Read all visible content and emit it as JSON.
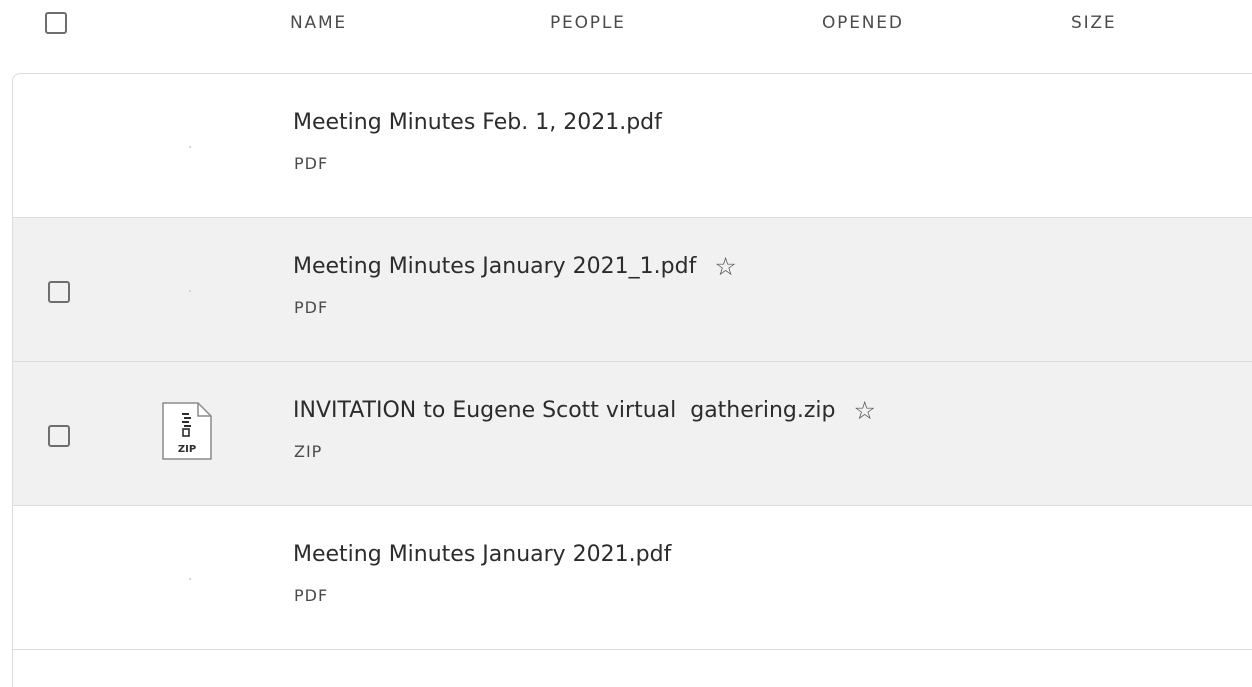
{
  "header": {
    "columns": {
      "name": "NAME",
      "people": "PEOPLE",
      "opened": "OPENED",
      "size": "SIZE"
    }
  },
  "files": [
    {
      "name": "Meeting Minutes Feb. 1, 2021.pdf",
      "type": "PDF",
      "starred_visible": false,
      "checkbox_visible": false,
      "highlighted": false,
      "icon": "pdf-thumbnail"
    },
    {
      "name": "Meeting Minutes January 2021_1.pdf",
      "type": "PDF",
      "starred_visible": true,
      "checkbox_visible": true,
      "highlighted": true,
      "icon": "pdf-thumbnail"
    },
    {
      "name": "INVITATION to Eugene Scott virtual  gathering.zip",
      "type": "ZIP",
      "starred_visible": true,
      "checkbox_visible": true,
      "highlighted": true,
      "icon": "zip-file-icon",
      "icon_label": "ZIP"
    },
    {
      "name": "Meeting Minutes January 2021.pdf",
      "type": "PDF",
      "starred_visible": false,
      "checkbox_visible": false,
      "highlighted": false,
      "icon": "pdf-thumbnail"
    }
  ],
  "icons": {
    "star": "star-outline-icon",
    "checkbox": "checkbox-unchecked-icon"
  },
  "colors": {
    "hover_row": "#f1f1f1",
    "border": "#dcdcdc",
    "text": "#2c2c2c",
    "muted": "#4b4b4b"
  }
}
